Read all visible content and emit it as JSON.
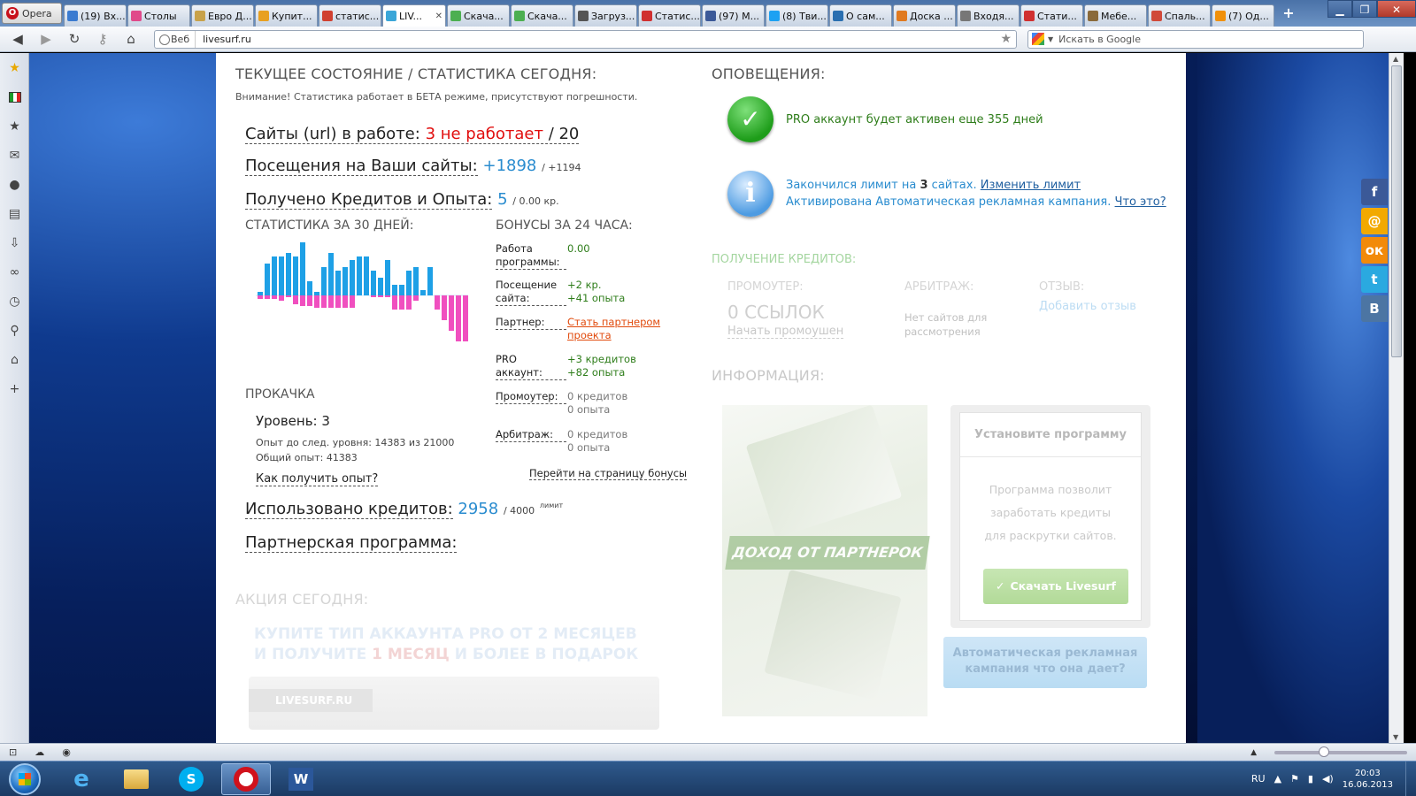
{
  "browser": {
    "opera_label": "Opera",
    "tabs": [
      {
        "label": "(19) Вх...",
        "color": "#3b7bd0"
      },
      {
        "label": "Столы",
        "color": "#e04a8a"
      },
      {
        "label": "Евро Д...",
        "color": "#c8a24a"
      },
      {
        "label": "Купит...",
        "color": "#e8a020"
      },
      {
        "label": "статис...",
        "color": "#d04030"
      },
      {
        "label": "LIV...",
        "color": "#3aa6d8",
        "active": true
      },
      {
        "label": "Скача...",
        "color": "#4caf50"
      },
      {
        "label": "Скача...",
        "color": "#4caf50"
      },
      {
        "label": "Загруз...",
        "color": "#555555"
      },
      {
        "label": "Статис...",
        "color": "#d03030"
      },
      {
        "label": "(97) М...",
        "color": "#3b5998"
      },
      {
        "label": "(8) Тви...",
        "color": "#1da1f2"
      },
      {
        "label": "О сам...",
        "color": "#2a6fb0"
      },
      {
        "label": "Доска ...",
        "color": "#e07a20"
      },
      {
        "label": "Входя...",
        "color": "#777777"
      },
      {
        "label": "Стати...",
        "color": "#d03030"
      },
      {
        "label": "Мебе...",
        "color": "#8a6a3a"
      },
      {
        "label": "Спаль...",
        "color": "#d04a3a"
      },
      {
        "label": "(7) Од...",
        "color": "#f0900a"
      }
    ],
    "address_prefix": "Веб",
    "url": "livesurf.ru",
    "search_placeholder": "Искать в Google"
  },
  "stats": {
    "heading": "ТЕКУЩЕЕ СОСТОЯНИЕ / СТАТИСТИКА СЕГОДНЯ:",
    "warning": "Внимание! Статистика работает в БЕТА режиме, присутствуют погрешности.",
    "sites_label": "Сайты (url) в работе:",
    "sites_not_working": "3 не работает",
    "sites_total": "/ 20",
    "visits_label": "Посещения на Ваши сайты:",
    "visits_value": "+1898",
    "visits_extra": "/ +1194",
    "credits_label": "Получено Кредитов и Опыта:",
    "credits_value": "5",
    "credits_extra": "/ 0.00 кр.",
    "chart_heading": "СТАТИСТИКА ЗА 30 ДНЕЙ:",
    "level_heading": "ПРОКАЧКА",
    "level_label": "Уровень: 3",
    "exp_next": "Опыт до след. уровня: 14383 из 21000",
    "exp_total": "Общий опыт: 41383",
    "how_exp": "Как получить опыт?",
    "used_label": "Использовано кредитов:",
    "used_value": "2958",
    "used_limit": "/ 4000",
    "limit_word": "лимит",
    "partner_label": "Партнерская программа:"
  },
  "chart_data": {
    "type": "bar",
    "title": "СТАТИСТИКА ЗА 30 ДНЕЙ:",
    "series": [
      {
        "values": [
          2,
          18,
          22,
          22,
          24,
          22,
          30,
          8,
          2,
          16,
          24,
          14,
          16,
          20,
          22,
          22,
          14,
          10,
          20,
          6,
          6,
          14,
          16,
          3,
          16,
          0,
          0,
          0,
          0,
          0
        ]
      },
      {
        "values": [
          -2,
          -2,
          -2,
          -3,
          -1,
          -5,
          -6,
          -6,
          -7,
          -7,
          -7,
          -7,
          -7,
          -7,
          0,
          0,
          -1,
          -1,
          -1,
          -8,
          -8,
          -8,
          -3,
          0,
          0,
          -8,
          -14,
          -20,
          -26,
          -26
        ]
      }
    ],
    "colors": [
      "#1ea0e6",
      "#f04fbf"
    ]
  },
  "bonus": {
    "heading": "БОНУСЫ ЗА 24 ЧАСА:",
    "rows": [
      {
        "label": "Работа программы:",
        "v1": "0.00",
        "v2": "",
        "style": "green"
      },
      {
        "label": "Посещение сайта:",
        "v1": "+2 кр.",
        "v2": "+41 опыта",
        "style": "green"
      },
      {
        "label": "Партнер:",
        "v1": "Стать партнером проекта",
        "v2": "",
        "style": "link"
      },
      {
        "label": "PRO аккаунт:",
        "v1": "+3 кредитов",
        "v2": "+82 опыта",
        "style": "green"
      },
      {
        "label": "Промоутер:",
        "v1": "0 кредитов",
        "v2": "0 опыта",
        "style": "gray"
      },
      {
        "label": "Арбитраж:",
        "v1": "0 кредитов",
        "v2": "0 опыта",
        "style": "gray"
      }
    ],
    "goto": "Перейти на страницу бонусы"
  },
  "action": {
    "heading": "АКЦИЯ СЕГОДНЯ:",
    "line1": "КУПИТЕ ТИП АККАУНТА PRO ОТ 2 МЕСЯЦЕВ",
    "line2a": "И ПОЛУЧИТЕ ",
    "line2b": "1 МЕСЯЦ",
    "line2c": " И БОЛЕЕ В ПОДАРОК",
    "banner": "LIVESURF.RU"
  },
  "alerts": {
    "heading": "ОПОВЕЩЕНИЯ:",
    "pro_text": "PRO аккаунт будет активен еще 355 дней",
    "limit_text_a": "Закончился лимит на",
    "limit_count": "3",
    "limit_text_b": "сайтах.",
    "limit_link": "Изменить лимит",
    "auto_text": "Активирована Автоматическая рекламная кампания.",
    "auto_link": "Что это?"
  },
  "credits": {
    "heading": "ПОЛУЧЕНИЕ КРЕДИТОВ:",
    "promoter_label": "ПРОМОУТЕР:",
    "promoter_value": "0 ССЫЛОК",
    "promoter_link": "Начать промоушен",
    "arbitrage_label": "АРБИТРАЖ:",
    "arbitrage_text": "Нет сайтов для рассмотрения",
    "review_label": "ОТЗЫВ:",
    "review_link": "Добавить отзыв"
  },
  "info": {
    "heading": "ИНФОРМАЦИЯ:",
    "money_label": "ДОХОД ОТ ПАРТНЕРОК",
    "install_title": "Установите программу",
    "install_text": "Программа позволит заработать кредиты для раскрутки сайтов.",
    "download": "Скачать Livesurf",
    "auto_button": "Автоматическая рекламная кампания что она дает?"
  },
  "taskbar": {
    "lang": "RU",
    "time": "20:03",
    "date": "16.06.2013"
  }
}
